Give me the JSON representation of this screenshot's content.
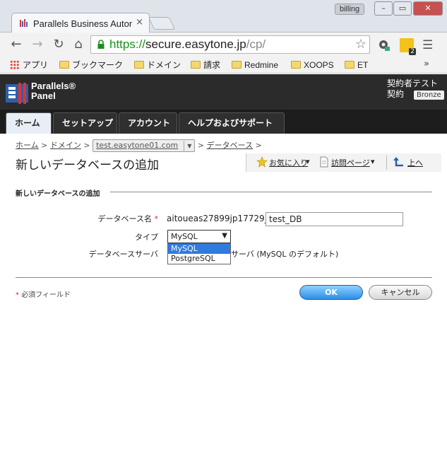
{
  "browser": {
    "tab_title": "Parallels Business Autom",
    "profile_label": "billing",
    "url": {
      "scheme": "https://",
      "host": "secure.easytone.jp",
      "path": "/cp/"
    },
    "extension_badge": "2",
    "bookmarks": [
      "アプリ",
      "ブックマーク",
      "ドメイン",
      "請求",
      "Redmine",
      "XOOPS",
      "ET"
    ],
    "more_label": "»"
  },
  "panel": {
    "brand_line1": "Parallels®",
    "brand_line2": "Panel",
    "user_line1": "契約者テスト",
    "user_line2": "契約",
    "plan_badge": "Bronze",
    "tabs": [
      {
        "label": "ホーム",
        "active": true
      },
      {
        "label": "セットアップ",
        "active": false
      },
      {
        "label": "アカウント",
        "active": false
      },
      {
        "label": "ヘルプおよびサポート",
        "active": false
      }
    ]
  },
  "breadcrumb": {
    "home": "ホーム",
    "domain": "ドメイン",
    "selected_domain": "test.easytone01.com",
    "database": "データベース",
    "sep": ">"
  },
  "page": {
    "title": "新しいデータベースの追加",
    "actions": {
      "favorites": "お気に入り",
      "visited": "訪問ページ",
      "up": "上へ"
    },
    "section_title": "新しいデータベースの追加",
    "form": {
      "db_name_label": "データベース名",
      "required_mark": "*",
      "db_prefix": "aitoueas27899jp17729_",
      "db_name_value": "test_DB",
      "type_label": "タイプ",
      "type_selected": "MySQL",
      "type_options": [
        "MySQL",
        "PostgreSQL"
      ],
      "server_label": "データベースサーバ",
      "server_value": "サーバ (MySQL のデフォルト)"
    },
    "required_note": "必須フィールド",
    "ok_label": "OK",
    "cancel_label": "キャンセル"
  }
}
